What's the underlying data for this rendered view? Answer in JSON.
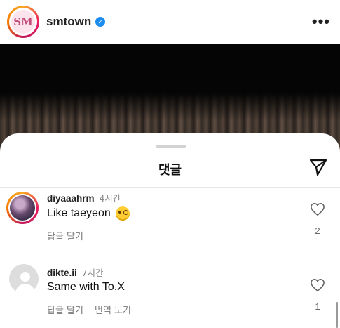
{
  "post": {
    "username": "smtown",
    "avatar_text": "SM",
    "verified": true,
    "more_label": "•••"
  },
  "comments_sheet": {
    "title": "댓글",
    "comments": [
      {
        "username": "diyaaahrm",
        "time": "4시간",
        "text": "Like taeyeon",
        "emoji": "face-with-monocle",
        "actions": [
          "답글 달기"
        ],
        "likes": "2"
      },
      {
        "username": "dikte.ii",
        "time": "7시간",
        "text": "Same with To.X",
        "actions": [
          "답글 달기",
          "번역 보기"
        ],
        "likes": "1"
      }
    ]
  },
  "colors": {
    "verified": "#1d8cf0",
    "story_ring": [
      "#f9a825",
      "#e91e63",
      "#c2185b",
      "#f57c00"
    ],
    "muted_text": "#777777"
  }
}
